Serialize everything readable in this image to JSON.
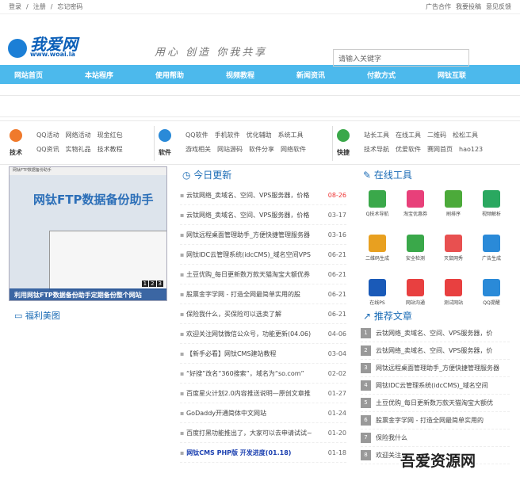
{
  "topbar": {
    "left": [
      "登录",
      "注册",
      "忘记密码"
    ],
    "right": [
      "广告合作",
      "我要投稿",
      "意见反馈"
    ]
  },
  "header": {
    "logo_text": "我爱网",
    "logo_url": "www.woai.la",
    "slogan": "用心 创造 你我共享",
    "search_placeholder": "请输入关键字"
  },
  "nav": [
    "网站首页",
    "本站程序",
    "使用帮助",
    "视频教程",
    "新闻资讯",
    "付款方式",
    "网钛互联"
  ],
  "links": [
    {
      "category": "技术",
      "color": "#f07a2c",
      "row1": [
        "QQ活动",
        "网络活动",
        "现金红包"
      ],
      "row2": [
        "QQ资讯",
        "实物礼品",
        "技术教程"
      ]
    },
    {
      "category": "软件",
      "color": "#2a8ad8",
      "row1": [
        "QQ软件",
        "手机软件",
        "优化辅助",
        "系统工具"
      ],
      "row2": [
        "游戏相关",
        "网站源码",
        "软件分享",
        "网络软件"
      ]
    },
    {
      "category": "快捷",
      "color": "#3aa84a",
      "row1": [
        "站长工具",
        "在线工具",
        "二维码",
        "松松工具"
      ],
      "row2": [
        "技术导航",
        "优爱软件",
        "赛网首页",
        "hao123"
      ]
    }
  ],
  "banner": {
    "window_title": "网钛FTP数据备份助手",
    "big_title": "网钛FTP数据备份助手",
    "caption": "利用网钛FTP数据备份助手定期备份整个网站",
    "pages": [
      "1",
      "2",
      "3"
    ]
  },
  "welfare_title": "福利美图",
  "today_title": "今日更新",
  "news": [
    {
      "title": "云钛网络_卖域名、空间、VPS服务器，价格",
      "date": "08-26",
      "hl": true
    },
    {
      "title": "云钛网络_卖域名、空间、VPS服务器，价格",
      "date": "03-17"
    },
    {
      "title": "网钛远程桌面管理助手_方便快捷管理服务器",
      "date": "03-16"
    },
    {
      "title": "网钛IDC云管理系统(idcCMS)_域名空间VPS",
      "date": "06-21"
    },
    {
      "title": "土豆优购_每日更新数万款天猫淘宝大额优券",
      "date": "06-21"
    },
    {
      "title": "股票金字学网 - 打造全网最简单实用的股",
      "date": "06-21"
    },
    {
      "title": "保险我什么，买保险可以选卖了解",
      "date": "06-21"
    },
    {
      "title": "欢迎关注网钛微信公众号，功能更新(04.06)",
      "date": "04-06"
    },
    {
      "title": "【新手必看】网钛CMS建站教程",
      "date": "03-04"
    },
    {
      "title": "“好搜”改名“360搜索”，域名为“so.com”",
      "date": "02-02"
    },
    {
      "title": "百度星火计划2.0内容推送说明—原创文章推",
      "date": "01-27"
    },
    {
      "title": "GoDaddy开通简体中文网站",
      "date": "01-24"
    },
    {
      "title": "百度打黑功能推出了，大家可以去申请试试~",
      "date": "01-20"
    },
    {
      "title": "网钛CMS PHP版 开发进度(01.18)",
      "date": "01-18",
      "bold": true
    }
  ],
  "tools_title": "在线工具",
  "tools": [
    {
      "label": "Q技术导航",
      "color": "#3aa84a"
    },
    {
      "label": "淘宝优惠券",
      "color": "#e8407a"
    },
    {
      "label": "刷排序",
      "color": "#4caa3a"
    },
    {
      "label": "视频解析",
      "color": "#2aa860"
    },
    {
      "label": "二维码生成",
      "color": "#e8a020"
    },
    {
      "label": "安全检测",
      "color": "#3aa84a"
    },
    {
      "label": "灭鼠网秀",
      "color": "#e85050"
    },
    {
      "label": "广告生成",
      "color": "#2a8ad8"
    },
    {
      "label": "在线PS",
      "color": "#1a5ab8"
    },
    {
      "label": "网站沟通",
      "color": "#e84040"
    },
    {
      "label": "测试网站",
      "color": "#e84040"
    },
    {
      "label": "QQ提醒",
      "color": "#2a8ad8"
    }
  ],
  "rec_title": "推荐文章",
  "recommended": [
    {
      "n": "1",
      "title": "云钛网络_卖域名、空间、VPS服务器，价"
    },
    {
      "n": "2",
      "title": "云钛网络_卖域名、空间、VPS服务器，价"
    },
    {
      "n": "3",
      "title": "网钛远程桌面管理助手_方便快捷管理服务器"
    },
    {
      "n": "4",
      "title": "网钛IDC云管理系统(idcCMS)_域名空间"
    },
    {
      "n": "5",
      "title": "土豆优购_每日更新数万款天猫淘宝大额优"
    },
    {
      "n": "6",
      "title": "股票金字学网 - 打造全网最简单实用的"
    },
    {
      "n": "7",
      "title": "保险我什么"
    },
    {
      "n": "8",
      "title": "欢迎关注"
    }
  ],
  "watermark": "吾爱资源网"
}
